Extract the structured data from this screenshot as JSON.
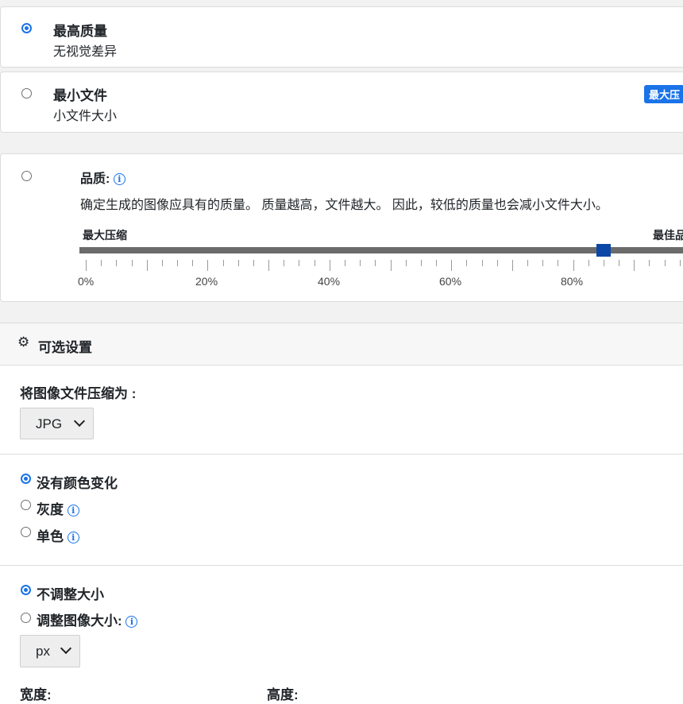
{
  "quality_options": [
    {
      "title": "最高质量",
      "subtitle": "无视觉差异",
      "selected": true
    },
    {
      "title": "最小文件",
      "subtitle": "小文件大小",
      "badge": "最大压",
      "selected": false
    }
  ],
  "custom_quality": {
    "label": "品质:",
    "description": "确定生成的图像应具有的质量。 质量越高，文件越大。 因此，较低的质量也会减小文件大小。",
    "min_label": "最大压缩",
    "max_label": "最佳品",
    "tick_labels": [
      "0%",
      "20%",
      "40%",
      "60%",
      "80%"
    ],
    "value_percent": 85,
    "selected": false
  },
  "optional_settings": {
    "header": "可选设置",
    "compress_to_label": "将图像文件压缩为 :",
    "format_value": "JPG",
    "color_options": [
      {
        "label": "没有颜色变化",
        "selected": true,
        "info": false
      },
      {
        "label": "灰度",
        "selected": false,
        "info": true
      },
      {
        "label": "单色",
        "selected": false,
        "info": true
      }
    ],
    "resize_options": [
      {
        "label": "不调整大小",
        "selected": true,
        "info": false
      },
      {
        "label": "调整图像大小:",
        "selected": false,
        "info": true
      }
    ],
    "unit_value": "px",
    "width_label": "宽度:",
    "height_label": "高度:"
  },
  "colors": {
    "accent": "#1a73e8",
    "handle": "#0b47a6"
  }
}
